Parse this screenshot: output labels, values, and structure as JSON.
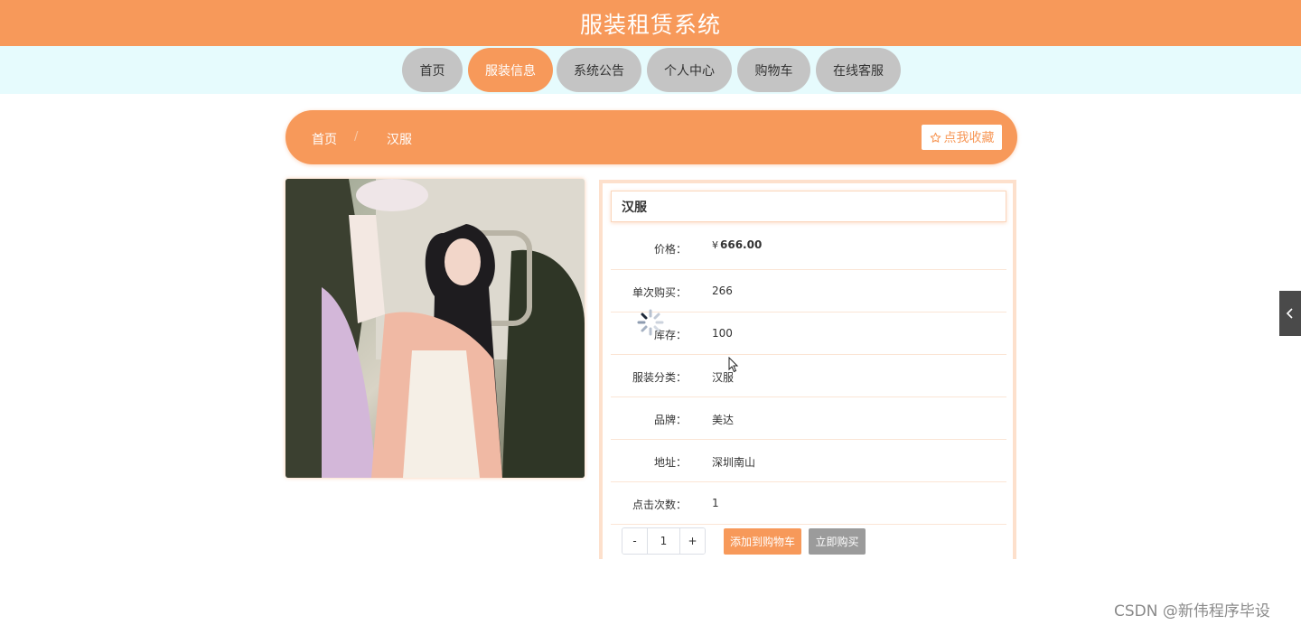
{
  "header": {
    "title": "服装租赁系统"
  },
  "nav": {
    "items": [
      {
        "label": "首页",
        "active": false
      },
      {
        "label": "服装信息",
        "active": true
      },
      {
        "label": "系统公告",
        "active": false
      },
      {
        "label": "个人中心",
        "active": false
      },
      {
        "label": "购物车",
        "active": false
      },
      {
        "label": "在线客服",
        "active": false
      }
    ]
  },
  "breadcrumb": {
    "home": "首页",
    "separator": "/",
    "current": "汉服",
    "favorite_label": "点我收藏",
    "favorite_icon": "star-icon"
  },
  "product": {
    "name": "汉服",
    "price_label": "价格：",
    "currency": "¥",
    "price": "666.00",
    "fields": [
      {
        "label": "单次购买：",
        "value": "266"
      },
      {
        "label": "库存：",
        "value": "100"
      },
      {
        "label": "服装分类：",
        "value": "汉服"
      },
      {
        "label": "品牌：",
        "value": "美达"
      },
      {
        "label": "地址：",
        "value": "深圳南山"
      },
      {
        "label": "点击次数：",
        "value": "1"
      }
    ],
    "quantity": {
      "minus": "-",
      "value": "1",
      "plus": "+"
    },
    "add_to_cart": "添加到购物车",
    "buy_now": "立即购买"
  },
  "colors": {
    "accent": "#f7995a",
    "nav_bg": "#e6fbfd",
    "nav_item": "#c4c4c4",
    "buy_now": "#9b9b9b"
  },
  "watermark": "CSDN @新伟程序毕设"
}
